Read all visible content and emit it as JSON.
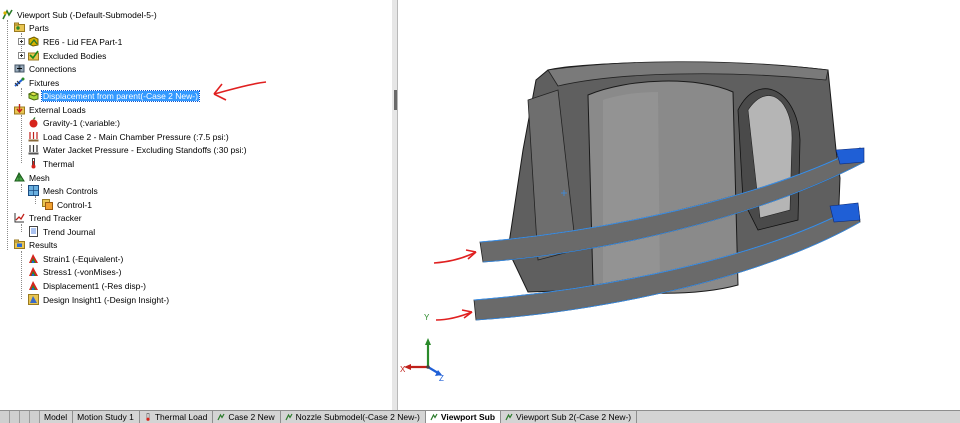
{
  "tree": {
    "root": {
      "label": "Viewport Sub (-Default-Submodel-5-)",
      "icon": "study-icon"
    },
    "nodes": [
      {
        "label": "Parts",
        "icon": "parts-folder-icon"
      },
      {
        "label": "RE6 - Lid FEA Part-1",
        "icon": "part-icon"
      },
      {
        "label": "Excluded Bodies",
        "icon": "excluded-bodies-icon"
      },
      {
        "label": "Connections",
        "icon": "connections-icon"
      },
      {
        "label": "Fixtures",
        "icon": "fixtures-icon"
      },
      {
        "label": "Displacement from parent(-Case 2 New-)",
        "icon": "displacement-fixture-icon"
      },
      {
        "label": "External Loads",
        "icon": "external-loads-icon"
      },
      {
        "label": "Gravity-1 (:variable:)",
        "icon": "gravity-icon"
      },
      {
        "label": "Load Case 2 - Main Chamber Pressure (:7.5 psi:)",
        "icon": "pressure-icon"
      },
      {
        "label": "Water Jacket Pressure - Excluding Standoffs (:30 psi:)",
        "icon": "pressure-icon"
      },
      {
        "label": "Thermal",
        "icon": "thermometer-icon"
      },
      {
        "label": "Mesh",
        "icon": "mesh-icon"
      },
      {
        "label": "Mesh Controls",
        "icon": "mesh-controls-icon"
      },
      {
        "label": "Control-1",
        "icon": "mesh-control-icon"
      },
      {
        "label": "Trend Tracker",
        "icon": "trend-tracker-icon"
      },
      {
        "label": "Trend Journal",
        "icon": "journal-icon"
      },
      {
        "label": "Results",
        "icon": "results-folder-icon"
      },
      {
        "label": "Strain1 (-Equivalent-)",
        "icon": "result-plot-icon"
      },
      {
        "label": "Stress1 (-vonMises-)",
        "icon": "result-plot-icon"
      },
      {
        "label": "Displacement1 (-Res disp-)",
        "icon": "result-plot-icon"
      },
      {
        "label": "Design Insight1 (-Design Insight-)",
        "icon": "design-insight-icon"
      }
    ]
  },
  "tabs": [
    {
      "label": "Model",
      "icon": ""
    },
    {
      "label": "Motion Study 1",
      "icon": ""
    },
    {
      "label": "Thermal Load",
      "icon": "thermometer-icon"
    },
    {
      "label": "Case 2 New",
      "icon": "study-icon"
    },
    {
      "label": "Nozzle Submodel(-Case 2 New-)",
      "icon": "study-icon"
    },
    {
      "label": "Viewport Sub",
      "icon": "study-icon"
    },
    {
      "label": "Viewport Sub 2(-Case 2 New-)",
      "icon": "study-icon"
    }
  ],
  "triad": {
    "x_label": "X",
    "y_label": "Y",
    "z_label": "Z"
  },
  "colors": {
    "selection": "#3399ff",
    "annotation_red": "#e02020",
    "model_gray": "#5f5f5f",
    "fixture_blue": "#1f5fd6",
    "edge_highlight": "#3a8fe8"
  }
}
